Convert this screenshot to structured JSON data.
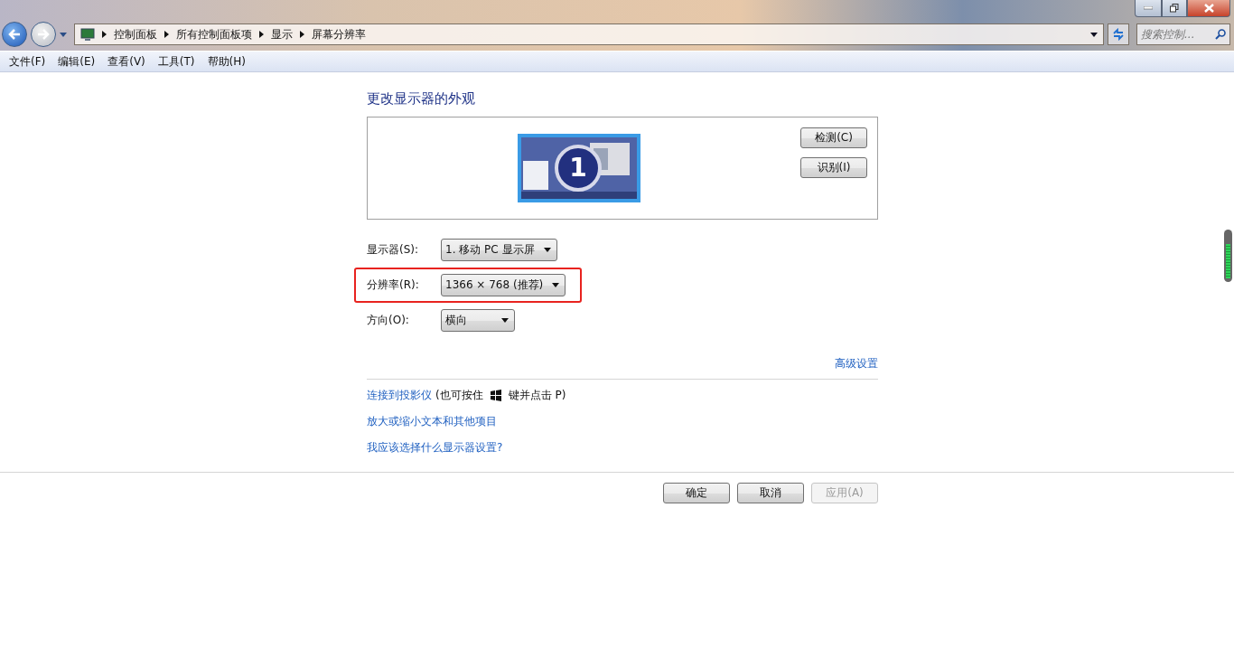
{
  "address_bar": {
    "path": [
      "控制面板",
      "所有控制面板项",
      "显示",
      "屏幕分辨率"
    ]
  },
  "search": {
    "placeholder": "搜索控制..."
  },
  "menu": [
    {
      "label": "文件(F)"
    },
    {
      "label": "编辑(E)"
    },
    {
      "label": "查看(V)"
    },
    {
      "label": "工具(T)"
    },
    {
      "label": "帮助(H)"
    }
  ],
  "heading": "更改显示器的外观",
  "monitor_preview": {
    "number": "1"
  },
  "preview_buttons": [
    {
      "label": "检测(C)"
    },
    {
      "label": "识别(I)"
    }
  ],
  "settings": [
    {
      "label": "显示器(S):",
      "value": "1. 移动 PC 显示屏",
      "highlighted": false
    },
    {
      "label": "分辨率(R):",
      "value": "1366 × 768 (推荐)",
      "highlighted": true
    },
    {
      "label": "方向(O):",
      "value": "横向",
      "highlighted": false
    }
  ],
  "advanced_link": "高级设置",
  "links": [
    {
      "text": "连接到投影仪",
      "hint": [
        "(也可按住",
        "键并点击 P)"
      ]
    },
    {
      "text": "放大或缩小文本和其他项目"
    },
    {
      "text": "我应该选择什么显示器设置?"
    }
  ],
  "buttons": [
    {
      "label": "确定",
      "disabled": false
    },
    {
      "label": "取消",
      "disabled": false
    },
    {
      "label": "应用(A)",
      "disabled": true
    }
  ]
}
